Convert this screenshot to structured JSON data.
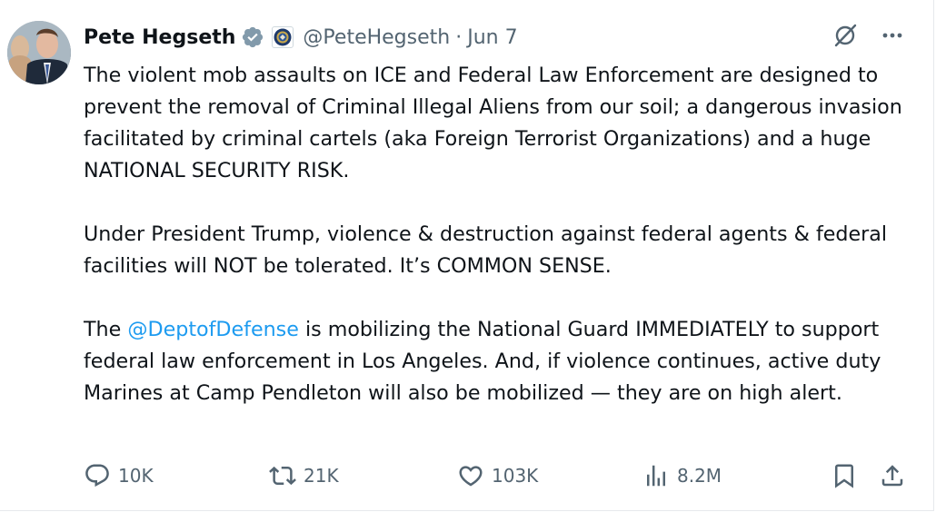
{
  "author": {
    "name": "Pete Hegseth",
    "handle": "@PeteHegseth",
    "separator": "·",
    "date": "Jun 7",
    "verified_icon": "gray-verified-badge-icon",
    "affiliation_icon": "dept-of-defense-seal-icon"
  },
  "tweet": {
    "paragraph1": "The violent mob assaults on ICE and Federal Law Enforcement are designed to prevent the removal of Criminal Illegal Aliens from our soil; a dangerous invasion facilitated by criminal cartels (aka Foreign Terrorist Organizations) and a huge NATIONAL SECURITY RISK.",
    "paragraph2": "Under President Trump, violence & destruction against federal agents & federal facilities will NOT be tolerated. It’s COMMON SENSE.",
    "paragraph3_before": "The ",
    "paragraph3_mention": "@DeptofDefense",
    "paragraph3_after": " is mobilizing the National Guard IMMEDIATELY to support federal law enforcement in Los Angeles. And, if violence continues, active duty Marines at Camp Pendleton will also be mobilized — they are on high alert."
  },
  "actions": {
    "replies": "10K",
    "reposts": "21K",
    "likes": "103K",
    "views": "8.2M"
  },
  "colors": {
    "text": "#0f1419",
    "secondary": "#536471",
    "link": "#1d9bf0"
  }
}
